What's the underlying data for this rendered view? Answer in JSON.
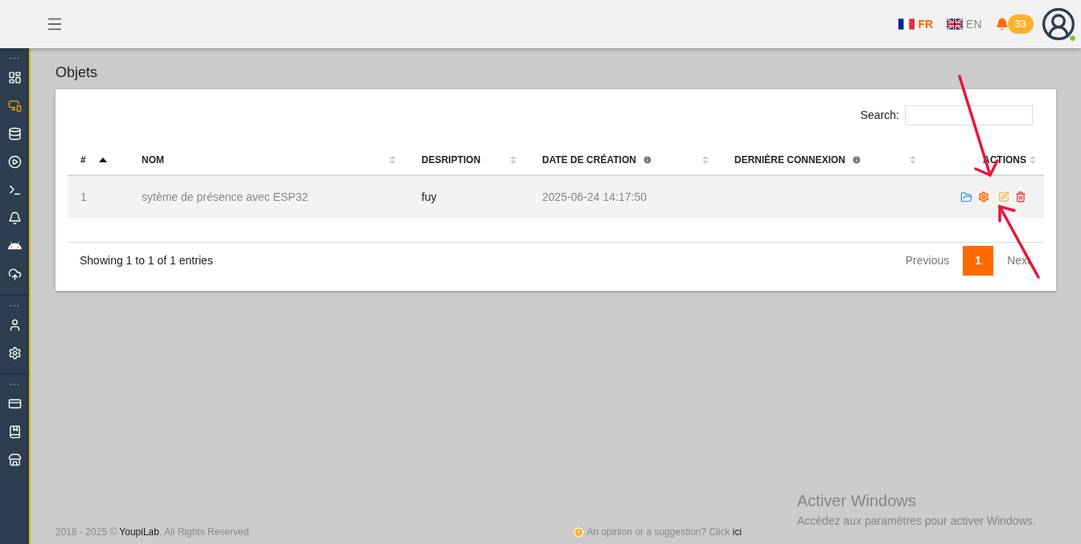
{
  "header": {
    "languages": [
      {
        "code": "FR",
        "selected": true
      },
      {
        "code": "EN",
        "selected": false
      }
    ],
    "notifications": "33",
    "user": {
      "online": true
    }
  },
  "sidebar": {
    "groups": [
      {
        "items": [
          {
            "selected": false
          },
          {
            "selected": true
          },
          {
            "selected": false
          },
          {
            "selected": false
          },
          {
            "selected": false
          },
          {
            "selected": false
          },
          {
            "selected": false
          },
          {
            "selected": false
          }
        ]
      },
      {
        "items": [
          {
            "selected": false
          },
          {
            "selected": false
          }
        ]
      },
      {
        "items": [
          {
            "selected": false
          },
          {
            "selected": false
          },
          {
            "selected": false
          }
        ]
      }
    ]
  },
  "page": {
    "title": "Objets"
  },
  "table": {
    "search_label": "Search:",
    "columns": [
      {
        "label": "#",
        "sorted": true
      },
      {
        "label": "NOM",
        "sorted": false
      },
      {
        "label": "DESRIPTION",
        "sorted": false
      },
      {
        "label": "DATE DE CRÉATION",
        "info": true,
        "sorted": false
      },
      {
        "label": "DERNIÈRE CONNEXION",
        "info": true,
        "sorted": false
      },
      {
        "label": "ACTIONS",
        "sorted": false
      }
    ],
    "rows": [
      {
        "cells": [
          "1",
          "sytème de présence avec ESP32",
          "fuy",
          "2025-06-24 14:17:50",
          ""
        ]
      }
    ],
    "info": "Showing 1 to 1 of 1 entries",
    "pagination": {
      "previous": "Previous",
      "pages": [
        {
          "label": "1",
          "selected": true
        }
      ],
      "next": "Next"
    }
  },
  "footer": {
    "copyright_prefix": "2018 - 2025 ©",
    "brand": "YoupiLab",
    "copyright_suffix": ". All Rights Reserved",
    "feedback": "An opinion or a suggestion? Click",
    "feedback_link": "ici"
  },
  "os_notice": {
    "title": "Activer Windows",
    "text": "Accédez aux paramètres pour activer Windows."
  }
}
